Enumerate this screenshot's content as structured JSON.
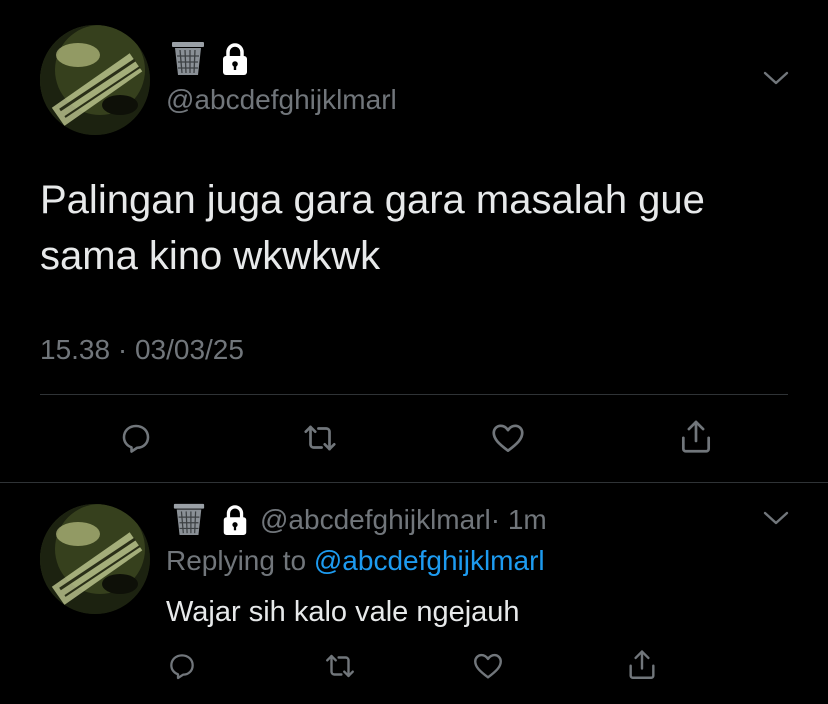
{
  "tweet": {
    "handle": "@abcdefghijklmarl",
    "text_line1": "Palingan juga gara gara masalah gue",
    "text_line2": "sama kino wkwkwk",
    "timestamp": "15.38 · 03/03/25",
    "actions": [
      "reply-icon",
      "retweet-icon",
      "like-icon",
      "share-icon"
    ]
  },
  "reply": {
    "handle": "@abcdefghijklmarl",
    "time": "· 1m",
    "replying_prefix": "Replying to",
    "replying_to": "@abcdefghijklmarl",
    "text": "Wajar sih kalo vale ngejauh",
    "actions": [
      "reply-icon",
      "retweet-icon",
      "like-icon",
      "share-icon"
    ]
  },
  "colors": {
    "background": "#000000",
    "text": "#e7e9ea",
    "muted": "#71767b",
    "link": "#1d9bf0",
    "divider": "#2f3336"
  }
}
